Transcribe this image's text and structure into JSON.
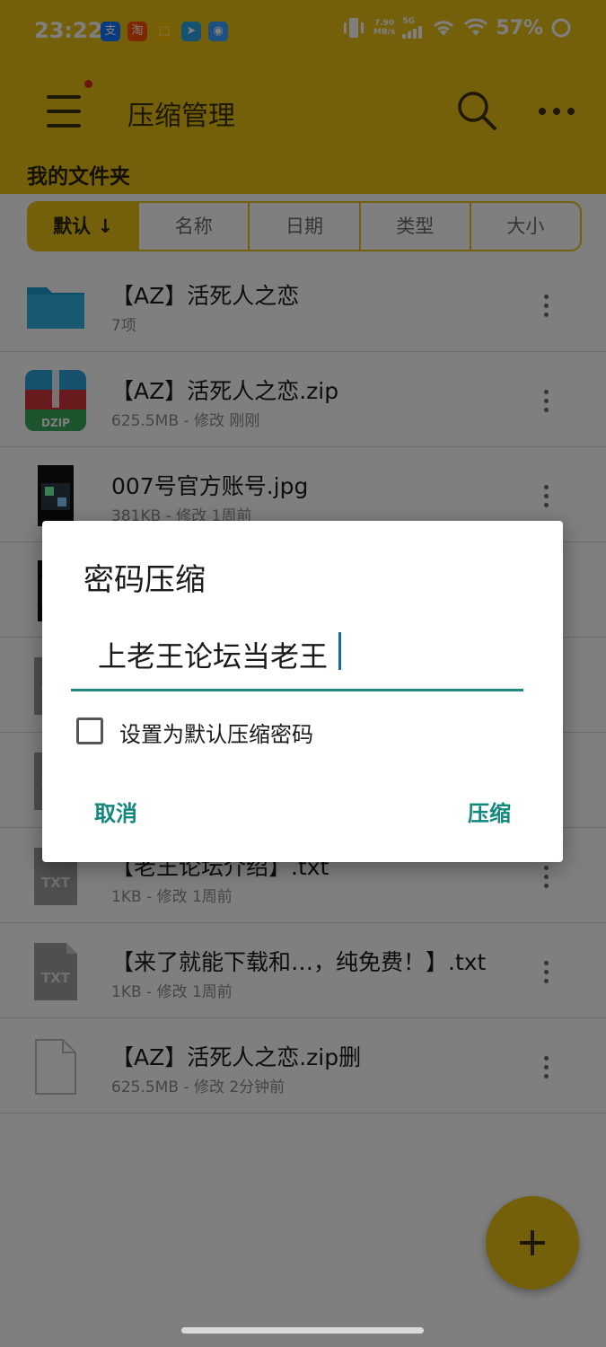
{
  "status_bar": {
    "time": "23:22",
    "net_speed_value": "7.90",
    "net_speed_unit": "MB/s",
    "network": "5G",
    "battery": "57%",
    "apps": [
      {
        "icon": "alipay-icon",
        "glyph": "支",
        "color": "#1677ff"
      },
      {
        "icon": "taobao-icon",
        "glyph": "淘",
        "color": "#ff5000"
      },
      {
        "icon": "app-store-icon",
        "glyph": "⬚",
        "color": "#f5c000"
      },
      {
        "icon": "telegram-icon",
        "glyph": "➤",
        "color": "#2aa3e1"
      },
      {
        "icon": "photo-app-icon",
        "glyph": "◉",
        "color": "#3aa0ff"
      }
    ]
  },
  "toolbar": {
    "title": "压缩管理"
  },
  "section": {
    "label": "我的文件夹"
  },
  "sort_tabs": [
    {
      "label": "默认 ↓",
      "active": true
    },
    {
      "label": "名称",
      "active": false
    },
    {
      "label": "日期",
      "active": false
    },
    {
      "label": "类型",
      "active": false
    },
    {
      "label": "大小",
      "active": false
    }
  ],
  "files": [
    {
      "name": "【AZ】活死人之恋",
      "meta": "7项",
      "icon": "folder-icon"
    },
    {
      "name": "【AZ】活死人之恋.zip",
      "meta": "625.5MB - 修改 刚刚",
      "icon": "zip-archive-icon"
    },
    {
      "name": "007号官方账号.jpg",
      "meta": "381KB - 修改 1周前",
      "icon": "image-thumbnail-icon"
    },
    {
      "name": "",
      "meta": "",
      "icon": "image-thumbnail-icon"
    },
    {
      "name": "",
      "meta": "",
      "icon": "txt-file-icon"
    },
    {
      "name": "",
      "meta": "",
      "icon": "txt-file-icon"
    },
    {
      "name": "【老王论坛介绍】.txt",
      "meta": "1KB - 修改 1周前",
      "icon": "txt-file-icon"
    },
    {
      "name": "【来了就能下载和…，纯免费！】.txt",
      "meta": "1KB - 修改 1周前",
      "icon": "txt-file-icon"
    },
    {
      "name": "【AZ】活死人之恋.zip删",
      "meta": "625.5MB - 修改 2分钟前",
      "icon": "blank-file-icon"
    }
  ],
  "dialog": {
    "title": "密码压缩",
    "password_value": "上老王论坛当老王",
    "checkbox_label": "设置为默认压缩密码",
    "checkbox_checked": false,
    "cancel_label": "取消",
    "confirm_label": "压缩"
  },
  "colors": {
    "accent": "#e8be17",
    "dialog_button": "#12877c",
    "input_underline": "#1f8a80"
  }
}
